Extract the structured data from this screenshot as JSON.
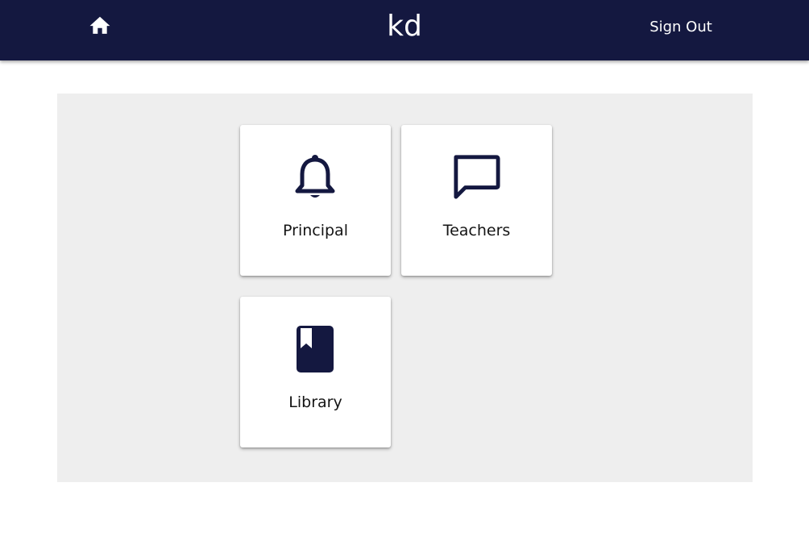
{
  "header": {
    "app_title": "kd",
    "sign_out_label": "Sign Out",
    "home_icon": "home-icon",
    "background_color": "#141840"
  },
  "tiles": [
    {
      "label": "Principal",
      "icon": "bell-icon"
    },
    {
      "label": "Teachers",
      "icon": "chat-bubble-icon"
    },
    {
      "label": "Library",
      "icon": "book-icon"
    }
  ],
  "colors": {
    "content_background": "#eeeeee",
    "icon_color": "#141840",
    "tile_background": "#ffffff"
  }
}
